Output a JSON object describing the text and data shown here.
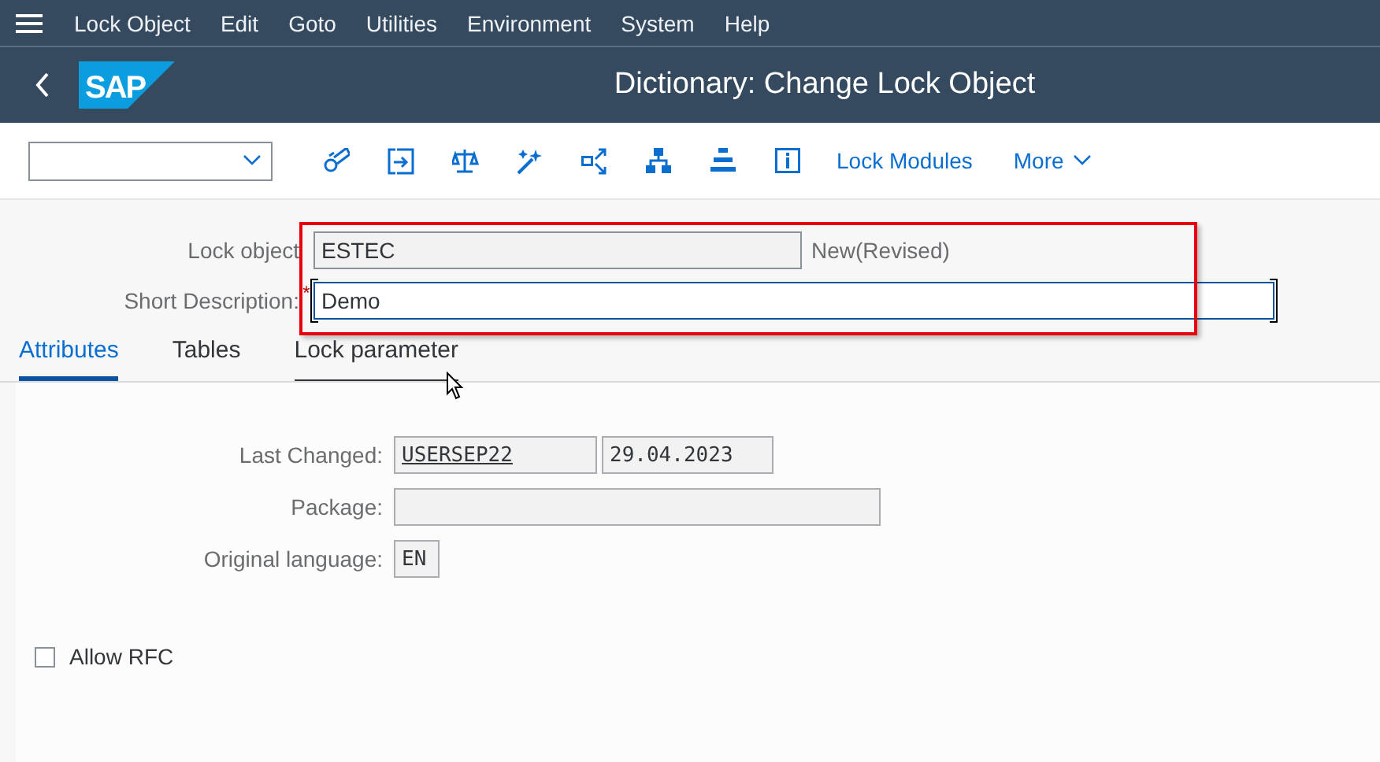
{
  "menu_bar": {
    "items": [
      "Lock Object",
      "Edit",
      "Goto",
      "Utilities",
      "Environment",
      "System",
      "Help"
    ]
  },
  "header": {
    "logo": "SAP",
    "title": "Dictionary: Change Lock Object"
  },
  "toolbar": {
    "buttons": [
      "Lock Modules"
    ],
    "more": "More"
  },
  "fields": [
    {
      "label": "Lock object",
      "value": "ESTEC",
      "status": "New(Revised)",
      "editable": false
    },
    {
      "label": "Short Description:",
      "required_mark": "*",
      "value": "Demo",
      "editable": true
    }
  ],
  "tabs": [
    {
      "label": "Attributes",
      "selected": true,
      "hovered": false
    },
    {
      "label": "Tables",
      "selected": false,
      "hovered": false
    },
    {
      "label": "Lock parameter",
      "selected": false,
      "hovered": true
    }
  ],
  "attributes": {
    "last_changed": {
      "label": "Last Changed:",
      "user": "USERSEP22",
      "date": "29.04.2023"
    },
    "package": {
      "label": "Package:"
    },
    "original_language": {
      "label": "Original language:",
      "value": "EN"
    }
  },
  "allow_rfc": {
    "label": "Allow RFC",
    "checked": false
  }
}
